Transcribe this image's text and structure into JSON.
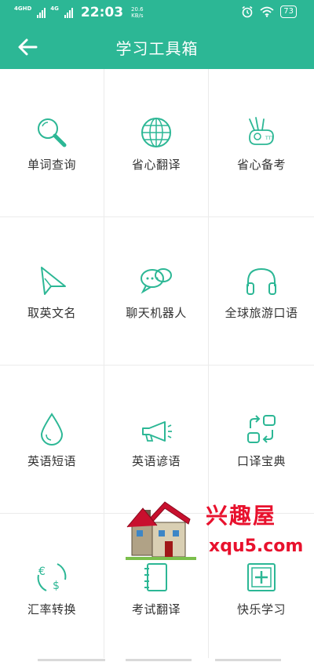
{
  "status_bar": {
    "network_1": "4GHD",
    "network_2": "4G",
    "time": "22:03",
    "speed_value": "20.6",
    "speed_unit": "KB/s",
    "battery": "73"
  },
  "app_bar": {
    "title": "学习工具箱",
    "back_icon": "arrow-left-icon"
  },
  "tools": [
    {
      "label": "单词查询",
      "icon": "magnifier-icon"
    },
    {
      "label": "省心翻译",
      "icon": "globe-icon"
    },
    {
      "label": "省心备考",
      "icon": "ok-hand-icon"
    },
    {
      "label": "取英文名",
      "icon": "paper-plane-icon"
    },
    {
      "label": "聊天机器人",
      "icon": "chat-bubbles-icon"
    },
    {
      "label": "全球旅游口语",
      "icon": "headphones-icon"
    },
    {
      "label": "英语短语",
      "icon": "water-drop-icon"
    },
    {
      "label": "英语谚语",
      "icon": "megaphone-icon"
    },
    {
      "label": "口译宝典",
      "icon": "swap-squares-icon"
    },
    {
      "label": "汇率转换",
      "icon": "currency-exchange-icon"
    },
    {
      "label": "考试翻译",
      "icon": "notebook-icon"
    },
    {
      "label": "快乐学习",
      "icon": "plus-frame-icon"
    }
  ],
  "watermark": {
    "brand": "兴趣屋",
    "url": "xqu5.com"
  },
  "colors": {
    "primary": "#2cb795",
    "icon_stroke": "#2cb795",
    "watermark": "#e8112d"
  }
}
